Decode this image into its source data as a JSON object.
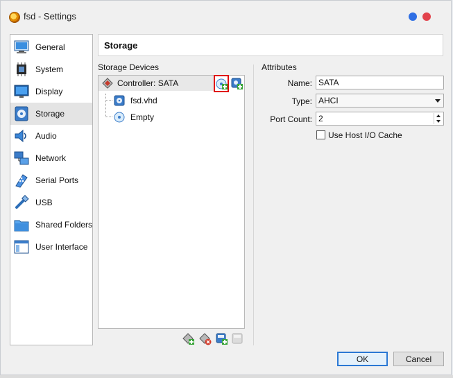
{
  "window": {
    "title": "fsd - Settings"
  },
  "sidebar": {
    "items": [
      {
        "label": "General",
        "icon": "general-icon"
      },
      {
        "label": "System",
        "icon": "system-icon"
      },
      {
        "label": "Display",
        "icon": "display-icon"
      },
      {
        "label": "Storage",
        "icon": "storage-icon",
        "selected": true
      },
      {
        "label": "Audio",
        "icon": "audio-icon"
      },
      {
        "label": "Network",
        "icon": "network-icon"
      },
      {
        "label": "Serial Ports",
        "icon": "serial-ports-icon"
      },
      {
        "label": "USB",
        "icon": "usb-icon"
      },
      {
        "label": "Shared Folders",
        "icon": "shared-folders-icon"
      },
      {
        "label": "User Interface",
        "icon": "user-interface-icon"
      }
    ]
  },
  "page": {
    "title": "Storage"
  },
  "storage_devices": {
    "heading": "Storage Devices",
    "controller": {
      "label": "Controller: SATA"
    },
    "attachments": [
      {
        "label": "fsd.vhd",
        "icon": "hard-disk-icon"
      },
      {
        "label": "Empty",
        "icon": "optical-disc-icon"
      }
    ]
  },
  "attributes": {
    "heading": "Attributes",
    "name_label": "Name:",
    "name_value": "SATA",
    "type_label": "Type:",
    "type_value": "AHCI",
    "port_count_label": "Port Count:",
    "port_count_value": "2",
    "host_io_cache_label": "Use Host I/O Cache",
    "host_io_cache_checked": false
  },
  "footer": {
    "ok_label": "OK",
    "cancel_label": "Cancel"
  },
  "colors": {
    "accent": "#2b78d4",
    "highlight": "#e00000",
    "dot_blue": "#2f6fe4",
    "dot_red": "#e2424b"
  }
}
